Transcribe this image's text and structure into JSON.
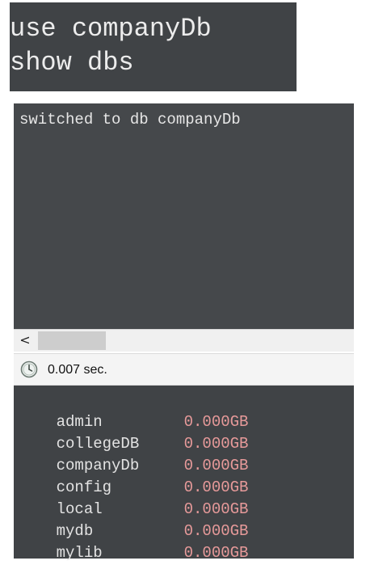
{
  "editor": {
    "lines": [
      "use companyDb",
      "show dbs"
    ]
  },
  "output": {
    "text": "switched to db companyDb"
  },
  "scrollbar": {
    "left_arrow": "<"
  },
  "status": {
    "elapsed": "0.007 sec."
  },
  "databases": [
    {
      "name": "admin",
      "size": "0.000GB"
    },
    {
      "name": "collegeDB",
      "size": "0.000GB"
    },
    {
      "name": "companyDb",
      "size": "0.000GB"
    },
    {
      "name": "config",
      "size": "0.000GB"
    },
    {
      "name": "local",
      "size": "0.000GB"
    },
    {
      "name": "mydb",
      "size": "0.000GB"
    },
    {
      "name": "mylib",
      "size": "0.000GB"
    }
  ],
  "colors": {
    "panel_bg": "#404346",
    "db_size": "#e79a9a",
    "text": "#e3e3e3"
  }
}
